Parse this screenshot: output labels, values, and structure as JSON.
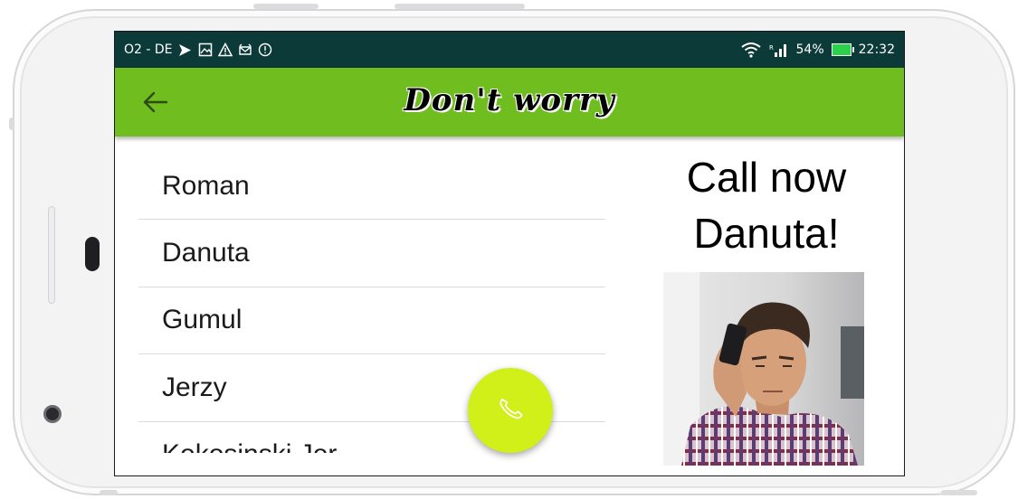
{
  "status_bar": {
    "carrier": "O2 - DE",
    "battery": "54%",
    "time": "22:32",
    "left_icons": [
      "navigation-icon",
      "image-icon",
      "warning-icon",
      "alarm-icon",
      "shield-icon"
    ],
    "right_icons": [
      "wifi-icon",
      "signal-icon",
      "battery-icon"
    ]
  },
  "app_bar": {
    "title": "Don't worry",
    "background": "#6fbd1f"
  },
  "contacts": [
    "Roman",
    "Danuta",
    "Gumul",
    "Jerzy",
    "Kokosinski Jer"
  ],
  "call_panel": {
    "line1": "Call now",
    "line2": "Danuta!"
  },
  "fab": {
    "icon": "phone-icon",
    "color": "#d1ef18"
  }
}
